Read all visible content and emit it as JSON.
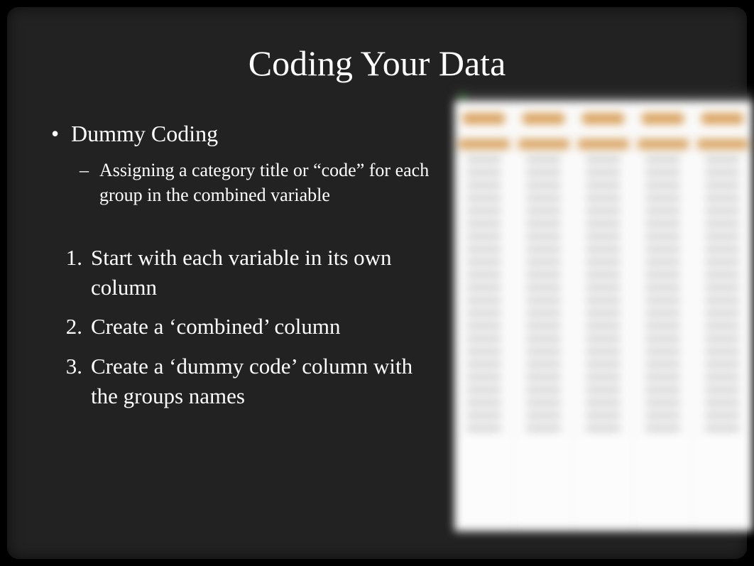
{
  "title": "Coding Your Data",
  "bullet": {
    "main": "Dummy Coding",
    "sub": "Assigning a category title or “code” for each group in the combined variable"
  },
  "steps": [
    "Start with each variable in its own column",
    "Create a ‘combined’ column",
    "Create a ‘dummy code’ column with the groups names"
  ]
}
